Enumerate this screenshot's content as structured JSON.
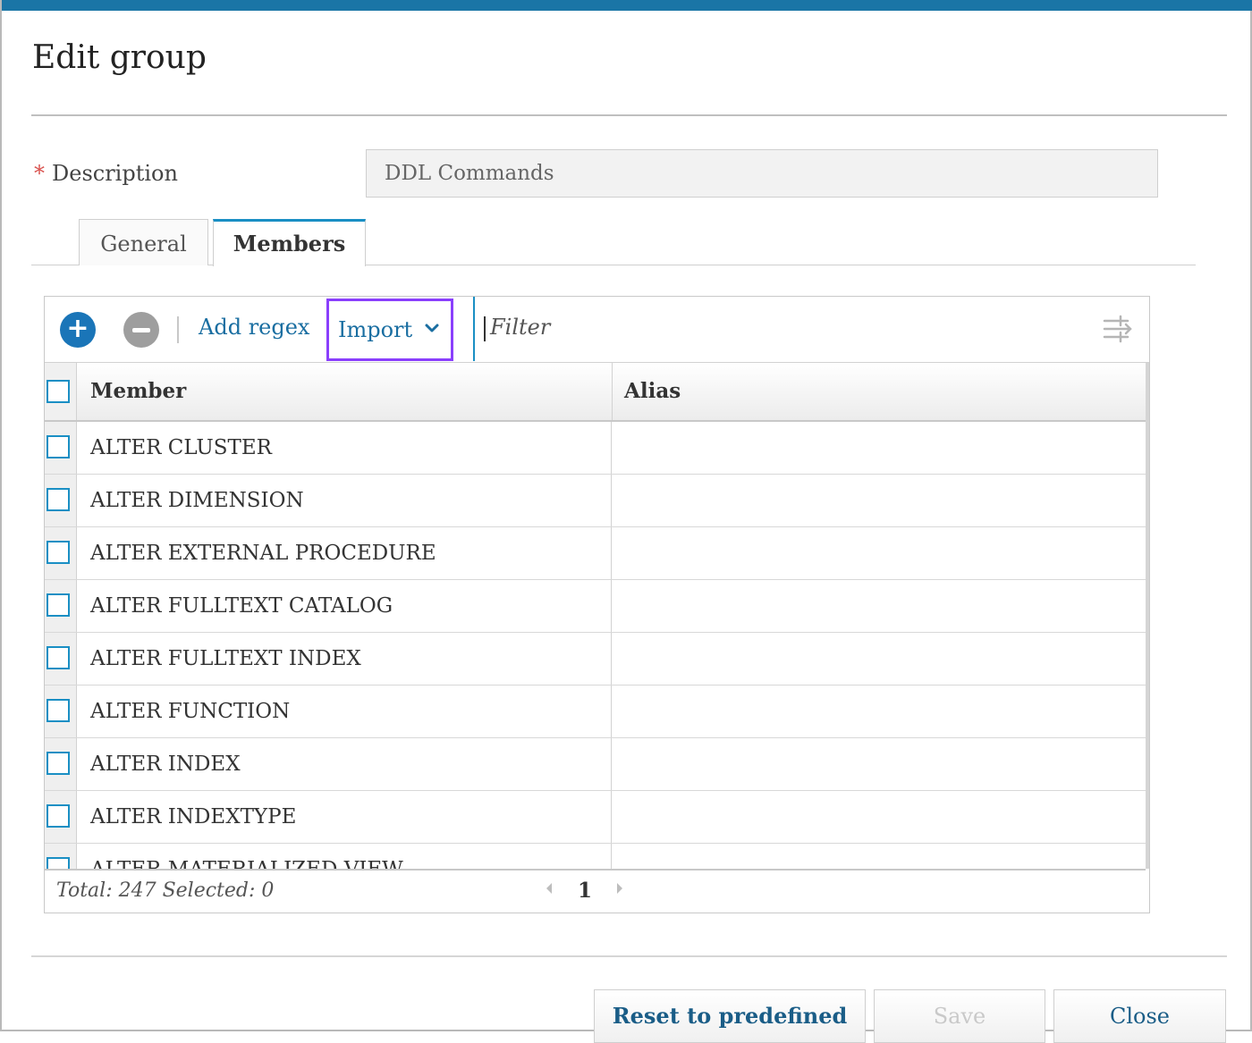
{
  "dialog": {
    "title": "Edit group"
  },
  "description": {
    "required_marker": "*",
    "label": "Description",
    "value": "DDL Commands"
  },
  "tabs": [
    {
      "label": "General",
      "active": false
    },
    {
      "label": "Members",
      "active": true
    }
  ],
  "toolbar": {
    "add_icon": "plus-circle-icon",
    "remove_icon": "minus-circle-icon",
    "add_regex_label": "Add regex",
    "import_label": "Import",
    "filter_placeholder": "Filter",
    "filter_options_icon": "filter-options-icon"
  },
  "table": {
    "columns": [
      "Member",
      "Alias"
    ],
    "rows": [
      {
        "member": "ALTER CLUSTER",
        "alias": ""
      },
      {
        "member": "ALTER DIMENSION",
        "alias": ""
      },
      {
        "member": "ALTER EXTERNAL PROCEDURE",
        "alias": ""
      },
      {
        "member": "ALTER FULLTEXT CATALOG",
        "alias": ""
      },
      {
        "member": "ALTER FULLTEXT INDEX",
        "alias": ""
      },
      {
        "member": "ALTER FUNCTION",
        "alias": ""
      },
      {
        "member": "ALTER INDEX",
        "alias": ""
      },
      {
        "member": "ALTER INDEXTYPE",
        "alias": ""
      },
      {
        "member": "ALTER MATERIALIZED VIEW",
        "alias": ""
      }
    ]
  },
  "footer": {
    "summary": "Total: 247 Selected: 0",
    "page": "1"
  },
  "buttons": {
    "reset_label": "Reset to predefined",
    "save_label": "Save",
    "close_label": "Close"
  },
  "colors": {
    "accent": "#1a75a6",
    "link": "#1a6ea1",
    "highlight": "#8a3ffc",
    "required": "#d9534f"
  }
}
